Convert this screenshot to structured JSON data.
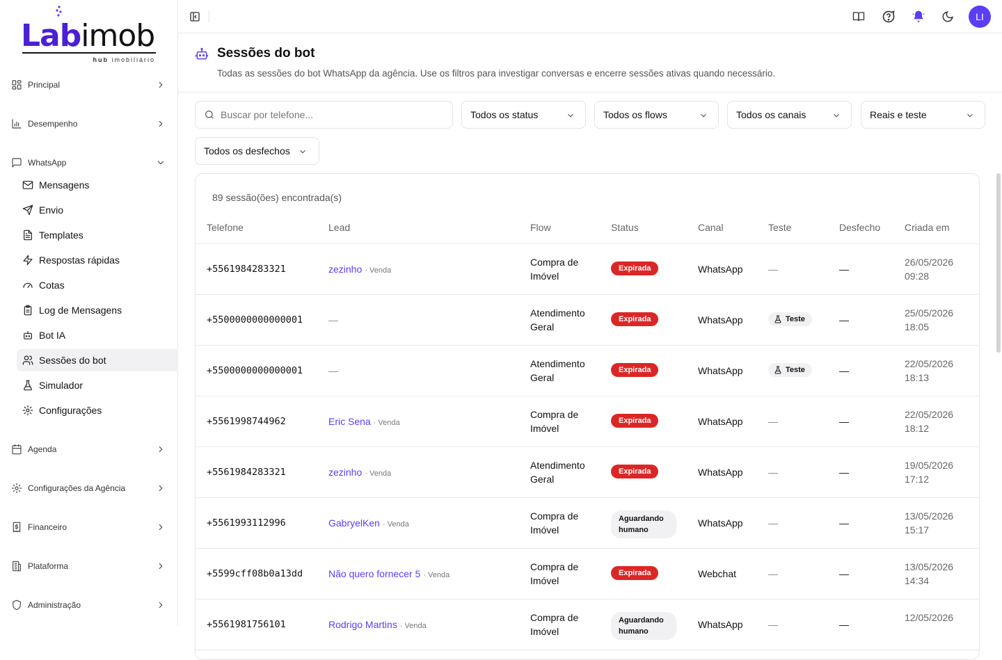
{
  "brand": {
    "logo_lab": "Lab",
    "logo_imob": "imob",
    "logo_sub_bold": "hub",
    "logo_sub": "imobiliário",
    "accent": "#5b3df5"
  },
  "sidebar": {
    "groups": [
      {
        "label": "Principal",
        "icon": "grid-icon"
      },
      {
        "label": "Desempenho",
        "icon": "bar-chart-icon"
      },
      {
        "label": "WhatsApp",
        "icon": "message-square-icon"
      },
      {
        "label": "Agenda",
        "icon": "calendar-icon"
      },
      {
        "label": "Configurações da Agência",
        "icon": "gear-icon"
      },
      {
        "label": "Financeiro",
        "icon": "receipt-icon"
      },
      {
        "label": "Plataforma",
        "icon": "building-icon"
      },
      {
        "label": "Administração",
        "icon": "shield-icon"
      }
    ],
    "whatsapp_items": [
      {
        "label": "Mensagens",
        "icon": "mail-icon"
      },
      {
        "label": "Envio",
        "icon": "send-icon"
      },
      {
        "label": "Templates",
        "icon": "file-text-icon"
      },
      {
        "label": "Respostas rápidas",
        "icon": "zap-icon"
      },
      {
        "label": "Cotas",
        "icon": "gauge-icon"
      },
      {
        "label": "Log de Mensagens",
        "icon": "clipboard-icon"
      },
      {
        "label": "Bot IA",
        "icon": "bot-icon"
      },
      {
        "label": "Sessões do bot",
        "icon": "users-icon",
        "active": true
      },
      {
        "label": "Simulador",
        "icon": "flask-icon"
      },
      {
        "label": "Configurações",
        "icon": "gear-icon"
      }
    ]
  },
  "topbar": {
    "avatar_initials": "LI"
  },
  "header": {
    "title": "Sessões do bot",
    "subtitle": "Todas as sessões do bot WhatsApp da agência. Use os filtros para investigar conversas e encerre sessões ativas quando necessário."
  },
  "filters": {
    "search_placeholder": "Buscar por telefone...",
    "status": "Todos os status",
    "flows": "Todos os flows",
    "canais": "Todos os canais",
    "modo": "Reais e teste",
    "desfechos": "Todos os desfechos"
  },
  "table": {
    "count": "89 sessão(ões) encontrada(s)",
    "columns": [
      "Telefone",
      "Lead",
      "Flow",
      "Status",
      "Canal",
      "Teste",
      "Desfecho",
      "Criada em"
    ],
    "rows": [
      {
        "phone": "+5561984283321",
        "lead": "zezinho",
        "lead_tag": "· Venda",
        "flow": "Compra de Imóvel",
        "status": "Expirada",
        "status_kind": "red",
        "canal": "WhatsApp",
        "teste": "—",
        "desfecho": "—",
        "created": "26/05/2026 09:28"
      },
      {
        "phone": "+5500000000000001",
        "lead": "",
        "lead_tag": "",
        "flow": "Atendimento Geral",
        "status": "Expirada",
        "status_kind": "red",
        "canal": "WhatsApp",
        "teste": "Teste",
        "desfecho": "—",
        "created": "25/05/2026 18:05"
      },
      {
        "phone": "+5500000000000001",
        "lead": "",
        "lead_tag": "",
        "flow": "Atendimento Geral",
        "status": "Expirada",
        "status_kind": "red",
        "canal": "WhatsApp",
        "teste": "Teste",
        "desfecho": "—",
        "created": "22/05/2026 18:13"
      },
      {
        "phone": "+5561998744962",
        "lead": "Eric Sena",
        "lead_tag": "· Venda",
        "flow": "Compra de Imóvel",
        "status": "Expirada",
        "status_kind": "red",
        "canal": "WhatsApp",
        "teste": "—",
        "desfecho": "—",
        "created": "22/05/2026 18:12"
      },
      {
        "phone": "+5561984283321",
        "lead": "zezinho",
        "lead_tag": "· Venda",
        "flow": "Atendimento Geral",
        "status": "Expirada",
        "status_kind": "red",
        "canal": "WhatsApp",
        "teste": "—",
        "desfecho": "—",
        "created": "19/05/2026 17:12"
      },
      {
        "phone": "+5561993112996",
        "lead": "GabryelKen",
        "lead_tag": "· Venda",
        "flow": "Compra de Imóvel",
        "status": "Aguardando humano",
        "status_kind": "gray",
        "canal": "WhatsApp",
        "teste": "—",
        "desfecho": "—",
        "created": "13/05/2026 15:17"
      },
      {
        "phone": "+5599cff08b0a13dd",
        "lead": "Não quero fornecer 5",
        "lead_tag": "· Venda",
        "flow": "Compra de Imóvel",
        "status": "Expirada",
        "status_kind": "red",
        "canal": "Webchat",
        "teste": "—",
        "desfecho": "—",
        "created": "13/05/2026 14:34"
      },
      {
        "phone": "+5561981756101",
        "lead": "Rodrigo Martins",
        "lead_tag": "· Venda",
        "flow": "Compra de Imóvel",
        "status": "Aguardando humano",
        "status_kind": "gray",
        "canal": "WhatsApp",
        "teste": "—",
        "desfecho": "—",
        "created": "12/05/2026"
      }
    ]
  }
}
